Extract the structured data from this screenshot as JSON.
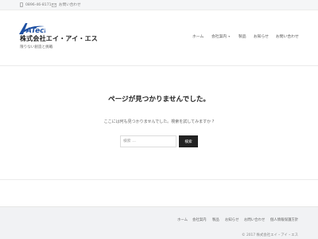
{
  "topbar": {
    "phone": "0896-46-8171",
    "contact": "お問い合わせ",
    "phone_icon": "phone-icon",
    "mail_icon": "mail-icon"
  },
  "header": {
    "logo_text": "ATech",
    "company_name": "株式会社エイ・アイ・エス",
    "tagline": "限りない創造と挑戦"
  },
  "nav": {
    "home": "ホーム",
    "company": "会社案内",
    "company_caret_icon": "chevron-down-icon",
    "products": "製品",
    "news": "お知らせ",
    "contact": "お問い合わせ"
  },
  "main": {
    "title": "ページが見つかりませんでした。",
    "message": "ここには何も見つかりませんでした。検索を試してみますか ?",
    "search_placeholder": "検索 …",
    "search_button": "検索"
  },
  "footer": {
    "links": [
      "ホーム",
      "会社案内",
      "製品",
      "お知らせ",
      "お問い合わせ",
      "個人情報保護方針"
    ],
    "copyright": "© 2017 株式会社エイ・アイ・エス"
  },
  "colors": {
    "accent": "#1e50a2",
    "button": "#222222",
    "footer_bg": "#f1f2f4"
  }
}
